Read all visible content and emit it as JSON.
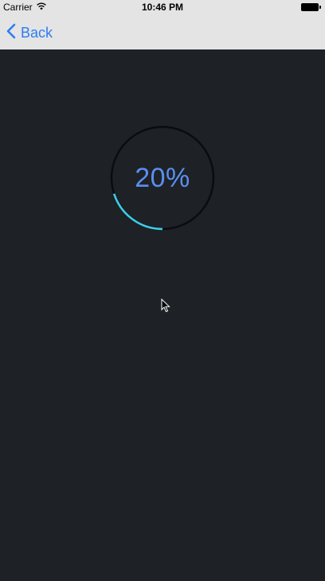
{
  "status_bar": {
    "carrier": "Carrier",
    "time": "10:46 PM",
    "wifi_icon": "wifi-icon",
    "battery_icon": "battery-icon"
  },
  "nav": {
    "back_label": "Back",
    "back_icon": "chevron-left-icon"
  },
  "progress": {
    "label": "20%",
    "value": 0.2,
    "track_color": "#0b0c0e",
    "fill_color": "#3bd1ec",
    "text_color": "#5a8ff0"
  },
  "colors": {
    "background": "#1e2126",
    "bar_background": "#e4e4e4",
    "accent": "#2f7cf6"
  }
}
